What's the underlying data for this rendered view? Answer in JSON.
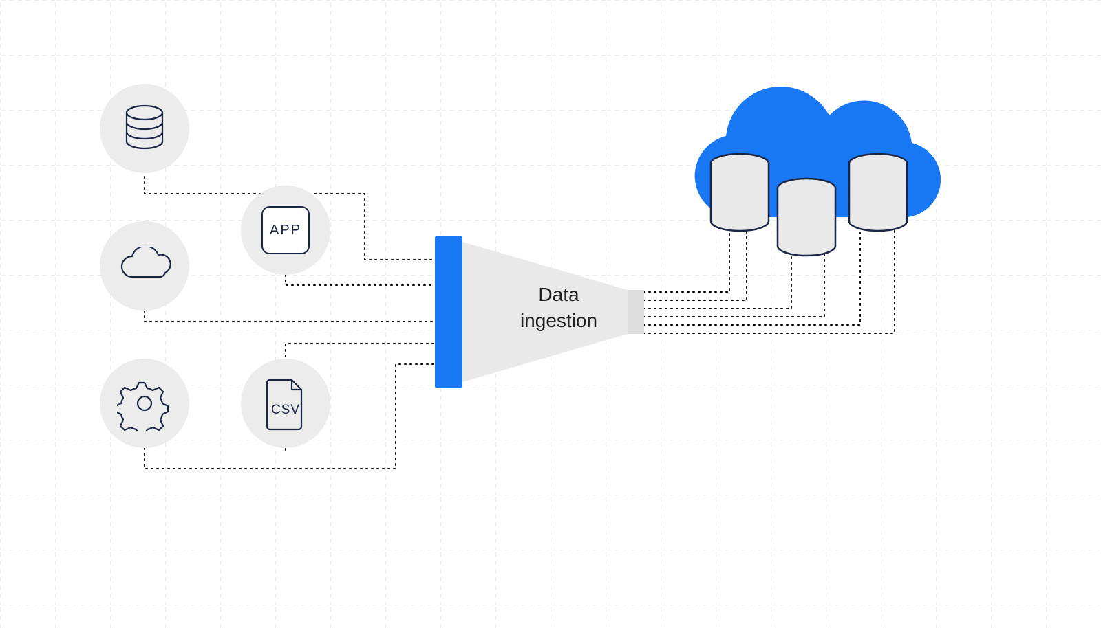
{
  "diagram": {
    "title": "Data ingestion",
    "sources": {
      "database": {
        "name": "database"
      },
      "app": {
        "label": "APP"
      },
      "cloud": {
        "name": "cloud"
      },
      "gear": {
        "name": "gear"
      },
      "csv": {
        "label": "CSV"
      }
    },
    "funnel": {
      "line1": "Data",
      "line2": "ingestion"
    },
    "destination": {
      "name": "cloud-databases",
      "db_count": 3
    },
    "colors": {
      "accent": "#1877f2",
      "node_bg": "#ececec",
      "stroke": "#1b2544",
      "funnel_fill": "#e9e9e9",
      "grid": "#d7d7d7"
    }
  }
}
